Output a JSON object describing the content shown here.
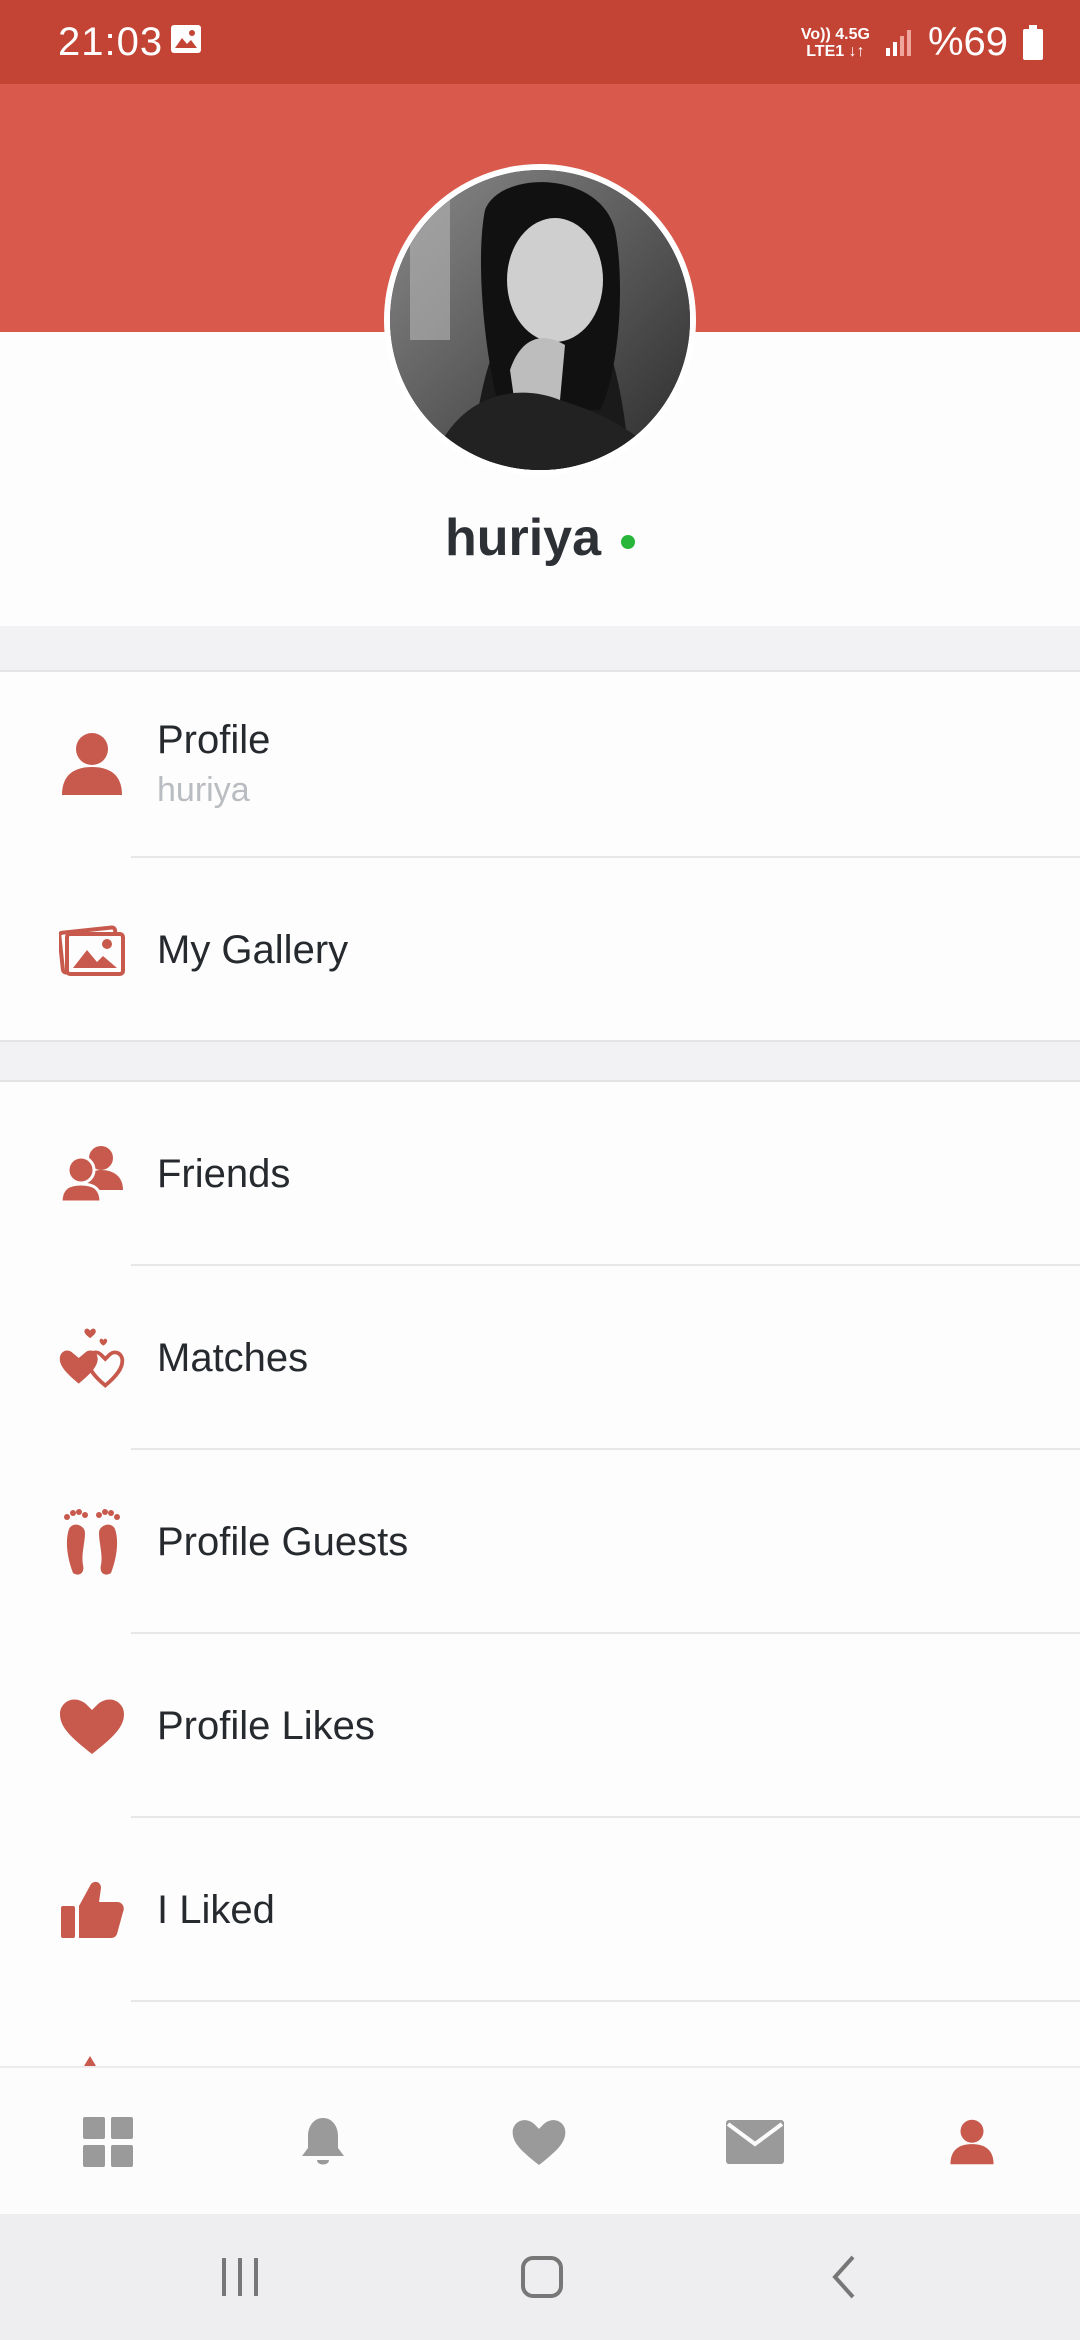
{
  "status_bar": {
    "time": "21:03",
    "network_line1": "Vo)) 4.5G",
    "network_line2": "LTE1 ↓↑",
    "battery": "%69"
  },
  "profile_header": {
    "username": "huriya",
    "online": true
  },
  "menu_group_1": [
    {
      "label": "Profile",
      "sublabel": "huriya",
      "icon": "person-icon"
    },
    {
      "label": "My Gallery",
      "icon": "gallery-icon"
    }
  ],
  "menu_group_2": [
    {
      "label": "Friends",
      "icon": "friends-icon"
    },
    {
      "label": "Matches",
      "icon": "hearts-icon"
    },
    {
      "label": "Profile Guests",
      "icon": "footprints-icon"
    },
    {
      "label": "Profile Likes",
      "icon": "heart-icon"
    },
    {
      "label": "I Liked",
      "icon": "thumbs-up-icon"
    }
  ],
  "bottom_nav": [
    {
      "icon": "grid-icon",
      "active": false
    },
    {
      "icon": "bell-icon",
      "active": false
    },
    {
      "icon": "heart-icon",
      "active": false
    },
    {
      "icon": "mail-icon",
      "active": false
    },
    {
      "icon": "person-icon",
      "active": true
    }
  ],
  "colors": {
    "accent": "#c75a4c",
    "header": "#d95a4c",
    "status_bar": "#c34434",
    "inactive_icon": "#9a9a9a",
    "online": "#27b53a"
  }
}
